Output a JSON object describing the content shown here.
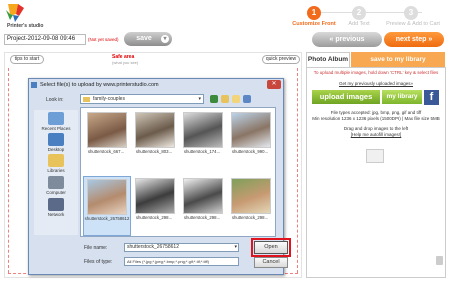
{
  "brand": {
    "name": "Printer's studio"
  },
  "steps": [
    {
      "number": "1",
      "label": "Customize Front",
      "active": true
    },
    {
      "number": "2",
      "label": "Add Text",
      "active": false
    },
    {
      "number": "3",
      "label": "Preview & Add to Cart",
      "active": false
    }
  ],
  "toolbar": {
    "project_name": "Project-2012-09-08 09:46",
    "not_saved": "(Not yet saved)",
    "save_label": "save",
    "previous_label": "« previous",
    "next_label": "next step »"
  },
  "canvas": {
    "tip_label": "tips to start",
    "safe_area_label": "Safe area",
    "safe_area_sub": "(what you see)",
    "quick_preview_label": "quick preview"
  },
  "photo_album": {
    "tab_label": "Photo Album",
    "save_library_label": "save to my library",
    "hint_upload_multiple": "To upload multiple images, hold down 'CTRL' key & select files",
    "hint_help_link": "Get my previously uploaded images»",
    "upload_label": "upload images",
    "my_library_label": "my library",
    "file_types": "File types accepted: jpg, bmp, png, gif and tiff",
    "resolution": "Min resolution 1236 x 1236 pixels (1500DPI) | Max file size 5MB",
    "drag_hint": "Drag and drop images to the left",
    "autofill_link": "[Help me autofill images!]"
  },
  "dialog": {
    "title": "Select file(s) to upload by www.printerstudio.com",
    "look_in_label": "Look in:",
    "look_in_value": "family-couples",
    "places": [
      "Recent Places",
      "Desktop",
      "Libraries",
      "Computer",
      "Network"
    ],
    "files": [
      {
        "name": "shutterstock_667...",
        "selected": false
      },
      {
        "name": "shutterstock_803...",
        "selected": false
      },
      {
        "name": "shutterstock_174...",
        "selected": false
      },
      {
        "name": "shutterstock_990...",
        "selected": false
      },
      {
        "name": "shutterstock_26758612",
        "selected": true
      },
      {
        "name": "shutterstock_298...",
        "selected": false
      },
      {
        "name": "shutterstock_298...",
        "selected": false
      },
      {
        "name": "shutterstock_298...",
        "selected": false
      }
    ],
    "file_name_label": "File name:",
    "file_name_value": "shutterstock_26758612",
    "file_type_label": "Files of type:",
    "file_type_value": "All Files (*.jpg;*.jpeg;*.bmp;*.png;*.gif;*.tif;*.tiff)",
    "open_label": "Open",
    "cancel_label": "Cancel"
  },
  "colors": {
    "accent_orange": "#f26a1b",
    "upload_green": "#7db52c",
    "facebook_blue": "#3b5998",
    "highlight_red": "#e0141e"
  }
}
